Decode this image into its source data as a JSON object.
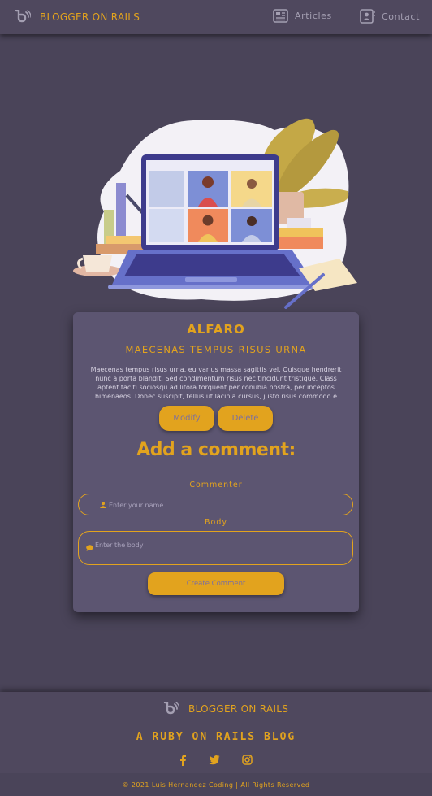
{
  "navbar": {
    "brand": "BLOGGER ON RAILS",
    "links": [
      {
        "label": "Articles",
        "icon": "newspaper-icon"
      },
      {
        "label": "Contact",
        "icon": "address-book-icon"
      }
    ]
  },
  "post": {
    "title": "ALFARO",
    "subtitle": "MAECENAS TEMPUS RISUS URNA",
    "body": "Maecenas tempus risus urna, eu varius massa sagittis vel. Quisque hendrerit nunc a porta blandit. Sed condimentum risus nec tincidunt tristique. Class aptent taciti sociosqu ad litora torquent per conubia nostra, per inceptos himenaeos. Donec suscipit, tellus ut lacinia cursus, justo risus commodo e",
    "modify_label": "Modify",
    "delete_label": "Delete"
  },
  "comment_form": {
    "heading": "Add a comment:",
    "commenter_label": "Commenter",
    "commenter_placeholder": "Enter your name",
    "body_label": "Body",
    "body_placeholder": "Enter the body",
    "submit_label": "Create Comment"
  },
  "footer": {
    "brand": "BLOGGER ON RAILS",
    "tagline": "A Ruby on Rails blog",
    "social": [
      "facebook-icon",
      "twitter-icon",
      "instagram-icon"
    ],
    "copyright": "© 2021 Luis Hernandez Coding | All Rights Reserved"
  },
  "colors": {
    "accent": "#e2a31e",
    "background": "#4a4459",
    "card": "#5c5571",
    "nav_text": "#a49fb2"
  }
}
